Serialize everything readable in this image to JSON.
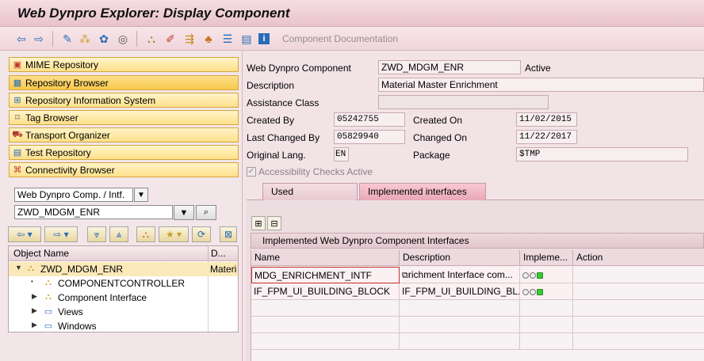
{
  "window": {
    "title": "Web Dynpro Explorer: Display Component"
  },
  "toolbar": {
    "icons": [
      "back-arrow-icon",
      "forward-arrow-icon",
      "switch-edit-icon",
      "other-object-icon",
      "activate-icon",
      "where-used-icon",
      "hierarchy-icon",
      "edit-icon",
      "move-icon",
      "tree-icon",
      "pretty-print-icon",
      "display-object-list-icon",
      "info-icon"
    ],
    "text_button": "Component Documentation"
  },
  "nav": {
    "items": [
      {
        "label": "MIME Repository",
        "icon": "mime-repository-icon"
      },
      {
        "label": "Repository Browser",
        "icon": "repository-browser-icon"
      },
      {
        "label": "Repository Information System",
        "icon": "info-system-icon"
      },
      {
        "label": "Tag Browser",
        "icon": "tag-browser-icon"
      },
      {
        "label": "Transport Organizer",
        "icon": "transport-icon"
      },
      {
        "label": "Test Repository",
        "icon": "test-repository-icon"
      },
      {
        "label": "Connectivity Browser",
        "icon": "connectivity-icon"
      }
    ]
  },
  "object_selector": {
    "type_value": "Web Dynpro Comp. / Intf.",
    "name_value": "ZWD_MDGM_ENR"
  },
  "tree": {
    "columns": [
      "Object Name",
      "D..."
    ],
    "rows": [
      {
        "label": "ZWD_MDGM_ENR",
        "desc": "Materia"
      },
      {
        "label": "COMPONENTCONTROLLER",
        "desc": ""
      },
      {
        "label": "Component Interface",
        "desc": ""
      },
      {
        "label": "Views",
        "desc": ""
      },
      {
        "label": "Windows",
        "desc": ""
      }
    ]
  },
  "details": {
    "component_label": "Web Dynpro Component",
    "component_value": "ZWD_MDGM_ENR",
    "status": "Active",
    "description_label": "Description",
    "description_value": "Material Master Enrichment",
    "assistance_label": "Assistance Class",
    "assistance_value": "",
    "created_by_label": "Created By",
    "created_by_value": "05242755",
    "created_on_label": "Created On",
    "created_on_value": "11/02/2015",
    "last_changed_by_label": "Last Changed By",
    "last_changed_by_value": "05829940",
    "changed_on_label": "Changed On",
    "changed_on_value": "11/22/2017",
    "orig_lang_label": "Original Lang.",
    "orig_lang_value": "EN",
    "package_label": "Package",
    "package_value": "$TMP",
    "accessibility_label": "Accessibility Checks Active"
  },
  "tabs": [
    "Used Components",
    "Implemented interfaces"
  ],
  "interfaces": {
    "title": "Implemented Web Dynpro Component Interfaces",
    "columns": [
      "Name",
      "Description",
      "Impleme...",
      "Action"
    ],
    "rows": [
      {
        "name": "MDG_ENRICHMENT_INTF",
        "description": "richment Interface com..."
      },
      {
        "name": "IF_FPM_UI_BUILDING_BLOCK",
        "description": "IF_FPM_UI_BUILDING_BL..."
      }
    ]
  },
  "colors": {
    "accent_yellow": "#fde089",
    "background": "#f2e3e6",
    "status_green": "#33cc33"
  }
}
